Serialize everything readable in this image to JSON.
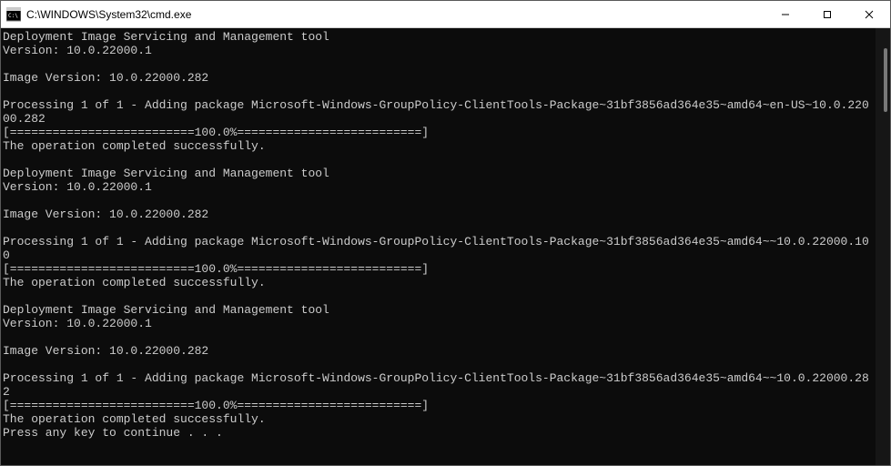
{
  "window": {
    "title": "C:\\WINDOWS\\System32\\cmd.exe",
    "icon": "cmd-icon"
  },
  "controls": {
    "minimize": "—",
    "maximize": "☐",
    "close": "✕"
  },
  "terminal": {
    "lines": [
      "Deployment Image Servicing and Management tool",
      "Version: 10.0.22000.1",
      "",
      "Image Version: 10.0.22000.282",
      "",
      "Processing 1 of 1 - Adding package Microsoft-Windows-GroupPolicy-ClientTools-Package~31bf3856ad364e35~amd64~en-US~10.0.22000.282",
      "[==========================100.0%==========================]",
      "The operation completed successfully.",
      "",
      "Deployment Image Servicing and Management tool",
      "Version: 10.0.22000.1",
      "",
      "Image Version: 10.0.22000.282",
      "",
      "Processing 1 of 1 - Adding package Microsoft-Windows-GroupPolicy-ClientTools-Package~31bf3856ad364e35~amd64~~10.0.22000.100",
      "[==========================100.0%==========================]",
      "The operation completed successfully.",
      "",
      "Deployment Image Servicing and Management tool",
      "Version: 10.0.22000.1",
      "",
      "Image Version: 10.0.22000.282",
      "",
      "Processing 1 of 1 - Adding package Microsoft-Windows-GroupPolicy-ClientTools-Package~31bf3856ad364e35~amd64~~10.0.22000.282",
      "[==========================100.0%==========================]",
      "The operation completed successfully.",
      "Press any key to continue . . ."
    ]
  }
}
